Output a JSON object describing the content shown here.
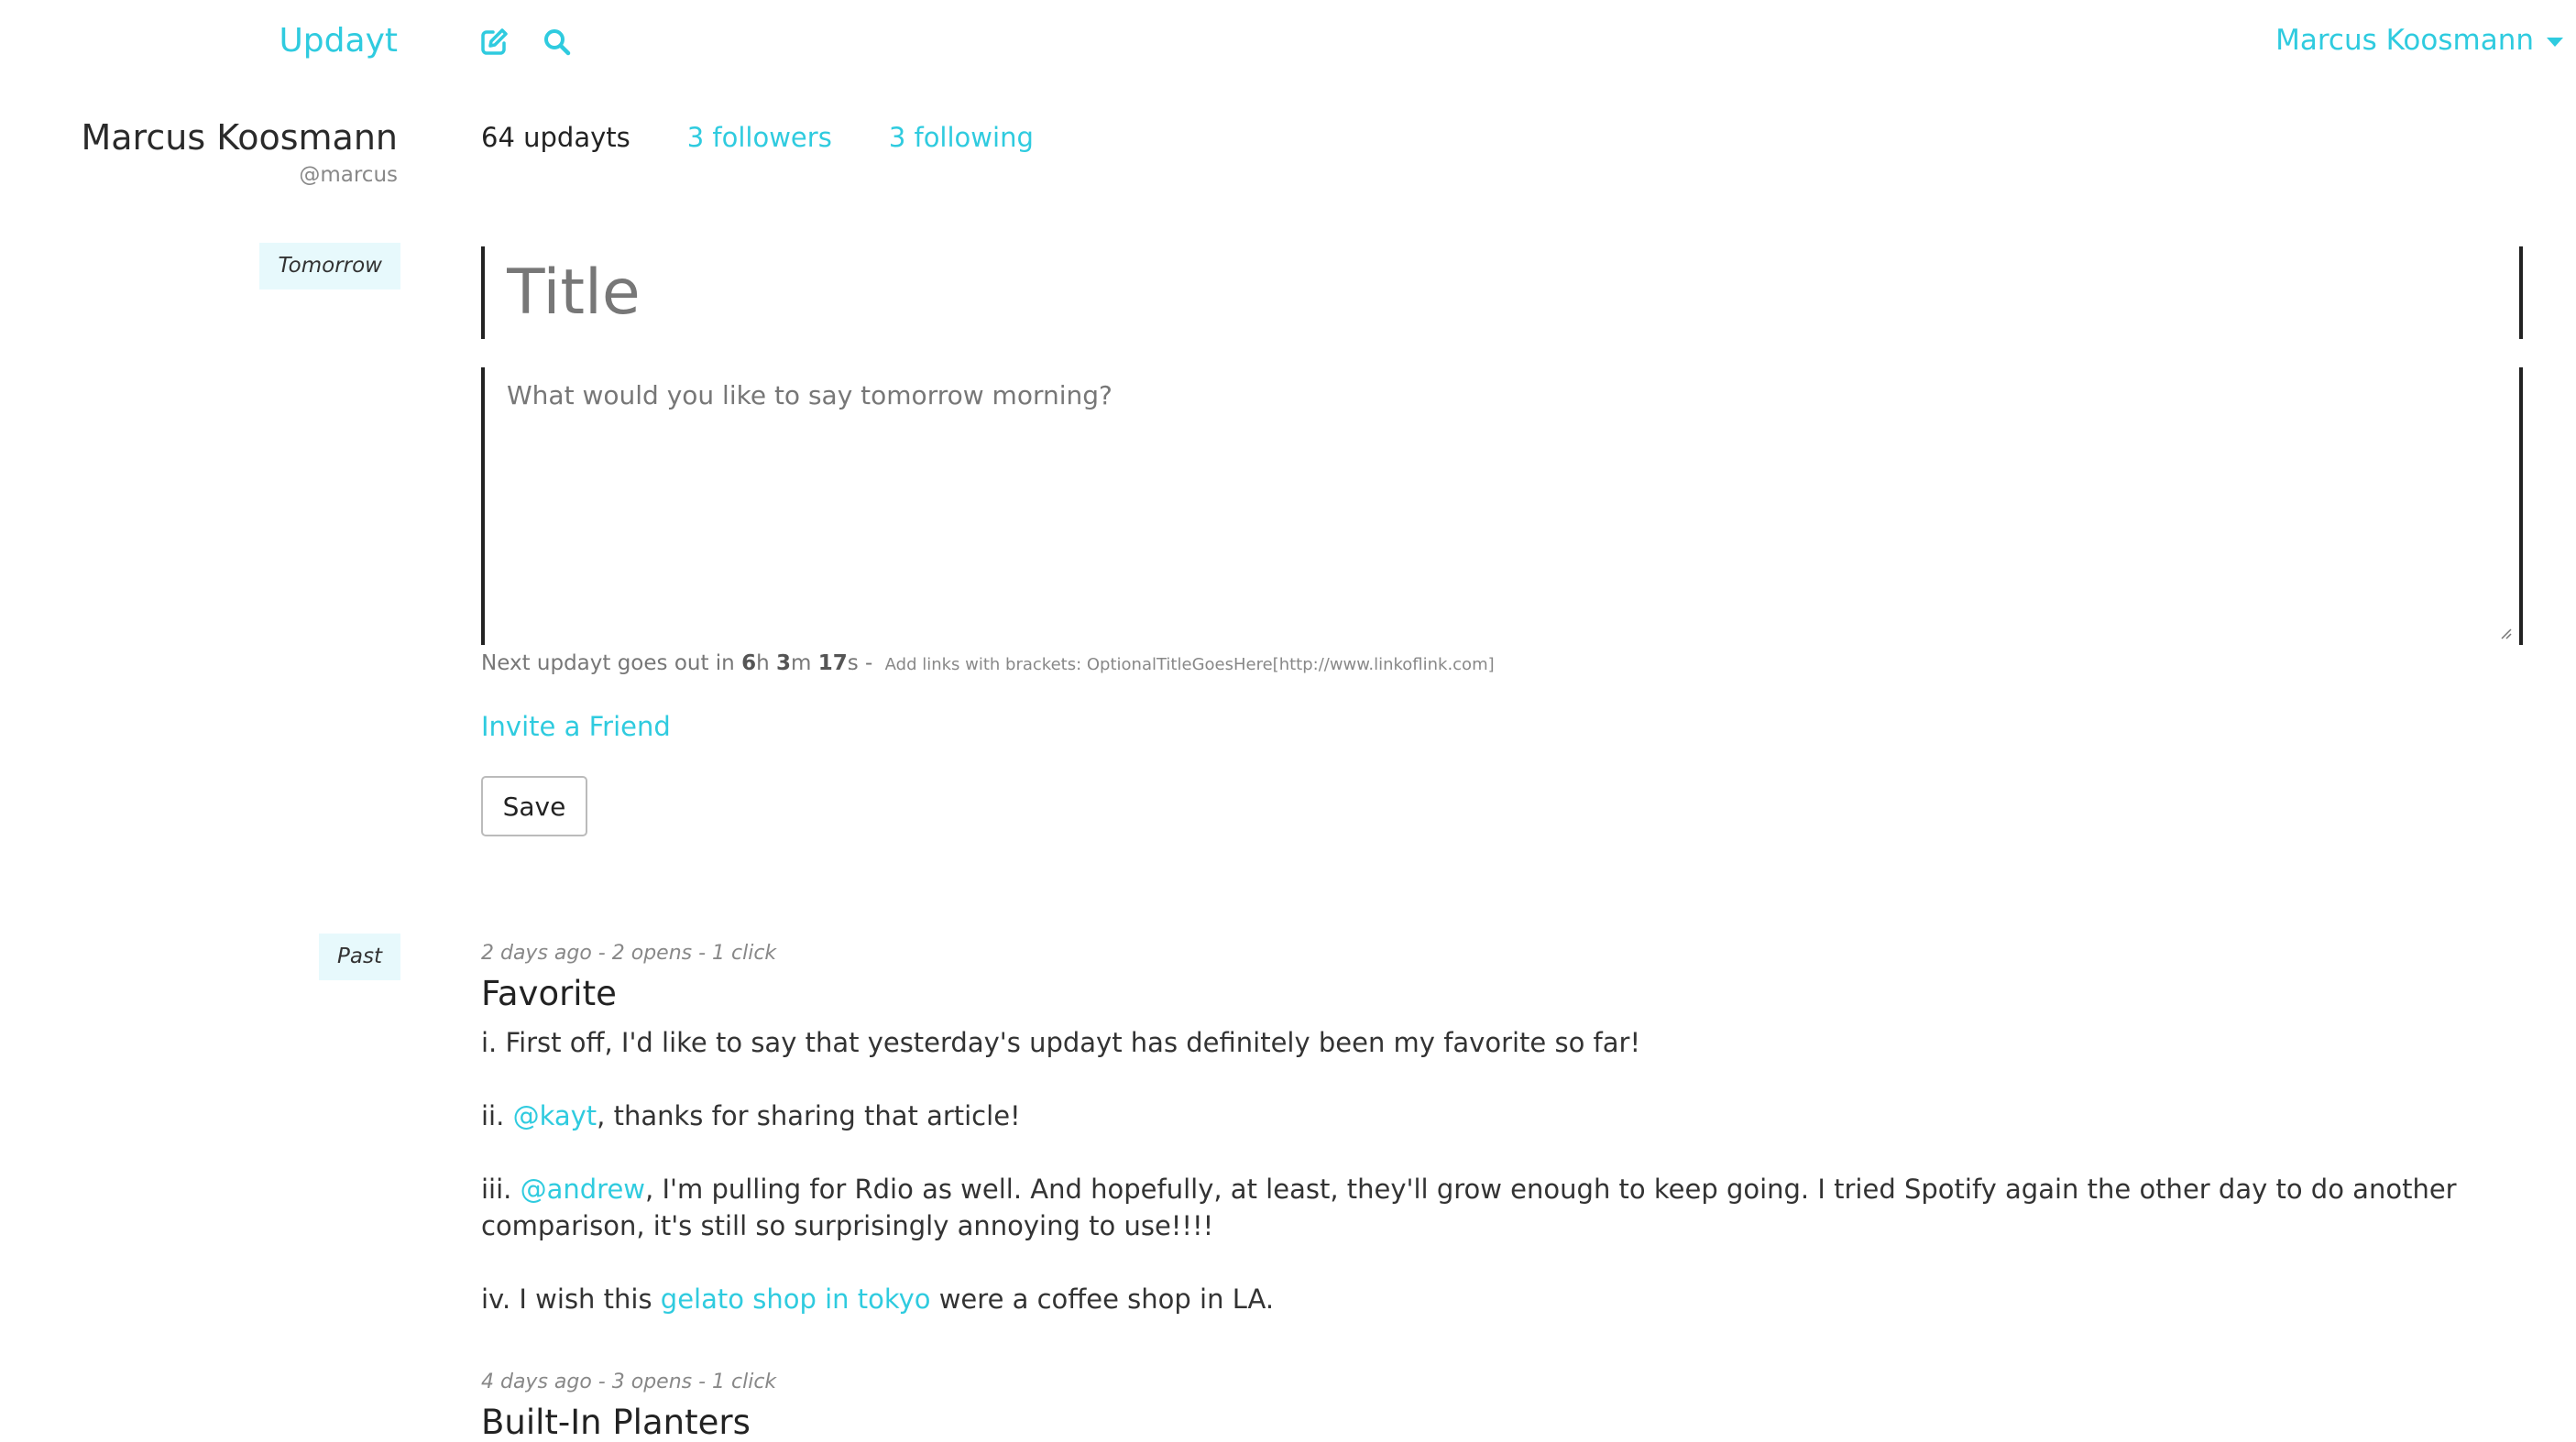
{
  "header": {
    "brand": "Updayt",
    "user_menu_label": "Marcus Koosmann"
  },
  "profile": {
    "name": "Marcus Koosmann",
    "handle": "@marcus",
    "stats": {
      "updayts": "64 updayts",
      "followers": "3 followers",
      "following": "3 following"
    }
  },
  "composer": {
    "section_tag": "Tomorrow",
    "title_placeholder": "Title",
    "body_placeholder": "What would you like to say tomorrow morning?",
    "timer_prefix": "Next updayt goes out in ",
    "timer_h": "6",
    "timer_h_unit": "h ",
    "timer_m": "3",
    "timer_m_unit": "m ",
    "timer_s": "17",
    "timer_s_unit": "s",
    "timer_sep": " - ",
    "hint": "Add links with brackets: OptionalTitleGoesHere[http://www.linkoflink.com]",
    "invite_label": "Invite a Friend",
    "save_label": "Save"
  },
  "past": {
    "section_tag": "Past",
    "posts": [
      {
        "meta": "2 days ago  - 2 opens - 1 click",
        "title": "Favorite",
        "p1": "i. First off, I'd like to say that yesterday's updayt has definitely been my favorite so far!",
        "p2_prefix": "ii. ",
        "p2_mention": "@kayt",
        "p2_rest": ", thanks for sharing that article!",
        "p3_prefix": "iii. ",
        "p3_mention": "@andrew",
        "p3_rest": ", I'm pulling for Rdio as well. And hopefully, at least, they'll grow enough to keep going. I tried Spotify again the other day to do another comparison, it's still so surprisingly annoying to use!!!!",
        "p4_prefix": "iv. I wish this ",
        "p4_link": "gelato shop in tokyo",
        "p4_rest": " were a coffee shop in LA."
      },
      {
        "meta": "4 days ago  - 3 opens - 1 click",
        "title": "Built-In Planters"
      }
    ]
  },
  "colors": {
    "accent": "#2fcbdf",
    "tag_bg": "#e7f9fc"
  },
  "icons": {
    "compose": "compose-icon",
    "search": "search-icon",
    "caret": "chevron-down-icon"
  }
}
